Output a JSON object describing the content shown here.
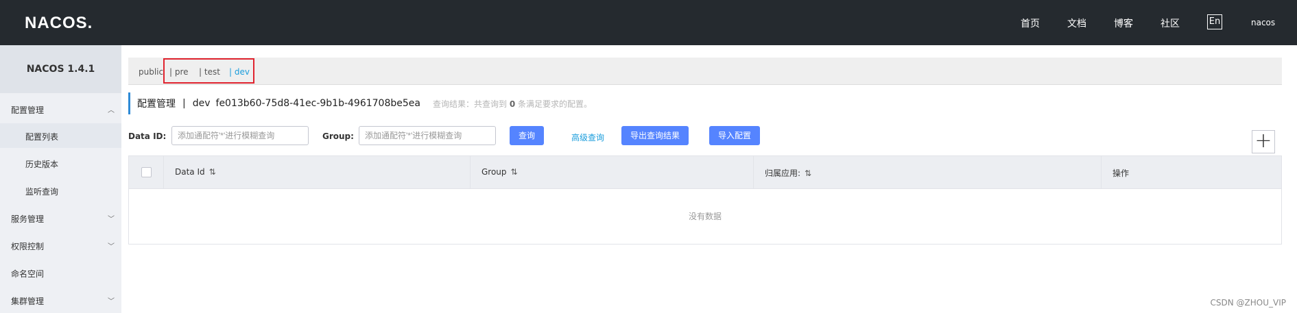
{
  "header": {
    "logo": "NACOS.",
    "nav": [
      "首页",
      "文档",
      "博客",
      "社区"
    ],
    "lang": "En",
    "user": "nacos"
  },
  "sidebar": {
    "title": "NACOS 1.4.1",
    "groups": [
      {
        "label": "配置管理",
        "expanded": true,
        "items": [
          "配置列表",
          "历史版本",
          "监听查询"
        ]
      },
      {
        "label": "服务管理",
        "expanded": false
      },
      {
        "label": "权限控制",
        "expanded": false
      },
      {
        "label": "命名空间"
      },
      {
        "label": "集群管理",
        "expanded": false
      }
    ]
  },
  "namespaces": {
    "items": [
      "public",
      "| pre",
      "| test",
      "| dev"
    ],
    "active": "dev"
  },
  "title": {
    "label": "配置管理",
    "separator": "|",
    "namespace": "dev",
    "namespace_id": "fe013b60-75d8-41ec-9b1b-4961708be5ea",
    "result_prefix": "查询结果：共查询到",
    "result_count": "0",
    "result_suffix": "条满足要求的配置。"
  },
  "search": {
    "data_id_label": "Data ID:",
    "data_id_placeholder": "添加通配符'*'进行模糊查询",
    "group_label": "Group:",
    "group_placeholder": "添加通配符'*'进行模糊查询",
    "query_btn": "查询",
    "advanced_link": "高级查询",
    "export_btn": "导出查询结果",
    "import_btn": "导入配置",
    "add_btn": "+"
  },
  "table": {
    "columns": [
      "Data Id",
      "Group",
      "归属应用:",
      "操作"
    ],
    "empty_text": "没有数据"
  },
  "watermark": "CSDN @ZHOU_VIP",
  "colors": {
    "header_bg": "#252a2f",
    "accent": "#5584ff",
    "link": "#1a9ddc",
    "highlight_border": "#e0232e"
  }
}
